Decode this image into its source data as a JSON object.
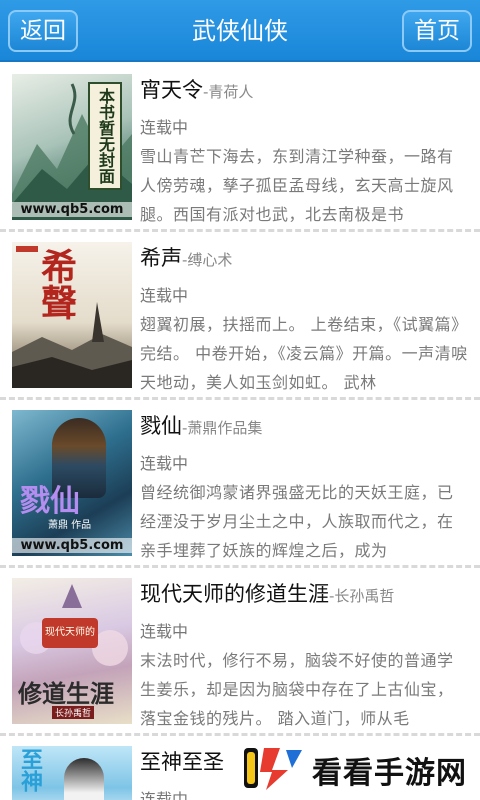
{
  "header": {
    "back_label": "返回",
    "title": "武侠仙侠",
    "home_label": "首页",
    "bg_color": "#1a86d8"
  },
  "books": [
    {
      "title": "宵天令",
      "author": "-青荷人",
      "status": "连载中",
      "desc": "雪山青芒下海去，东到清江学种蚕，一路有人傍劳魂，孳子孤臣孟母线，玄天高士旋风腿。西国有派对也武，北去南极是书",
      "cover_text": "本书暂无封面",
      "cover_url": "www.qb5.com"
    },
    {
      "title": "希声",
      "author": "-缚心术",
      "status": "连载中",
      "desc": "翅翼初展，扶摇而上。 上卷结束，《试翼篇》完结。 中卷开始，《凌云篇》开篇。一声清唳天地动，美人如玉剑如虹。 武林",
      "cover_text": "希聲"
    },
    {
      "title": "戮仙",
      "author": "-萧鼎作品集",
      "status": "连载中",
      "desc": "曾经统御鸿蒙诸界强盛无比的天妖王庭，已经湮没于岁月尘土之中，人族取而代之，在亲手埋葬了妖族的辉煌之后，成为",
      "cover_text": "戮仙",
      "cover_sub": "萧鼎 作品",
      "cover_url": "www.qb5.com"
    },
    {
      "title": "现代天师的修道生涯",
      "author": "-长孙禹哲",
      "status": "连载中",
      "desc": "末法时代，修行不易，脑袋不好使的普通学生姜乐，却是因为脑袋中存在了上古仙宝，落宝金钱的残片。 踏入道门，师从毛",
      "cover_text": "修道生涯",
      "cover_tag": "现代天师的",
      "cover_sub": "长孙禹哲"
    },
    {
      "title": "至神至圣",
      "author": "",
      "status": "连载中",
      "desc": "",
      "cover_text": "至神"
    }
  ],
  "watermark": {
    "text": "看看手游网",
    "icon": "kk-logo-icon"
  }
}
